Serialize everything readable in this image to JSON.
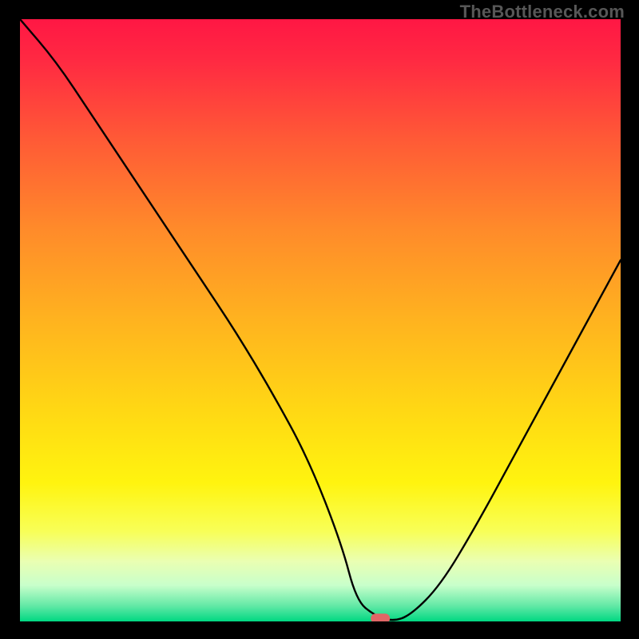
{
  "watermark": "TheBottleneck.com",
  "chart_data": {
    "type": "line",
    "title": "",
    "xlabel": "",
    "ylabel": "",
    "xlim": [
      0,
      100
    ],
    "ylim": [
      0,
      100
    ],
    "grid": false,
    "series": [
      {
        "name": "bottleneck-curve",
        "x": [
          0,
          6,
          12,
          18,
          24,
          30,
          36,
          42,
          48,
          53.5,
          56,
          59,
          62,
          65,
          70,
          76,
          82,
          88,
          94,
          100
        ],
        "values": [
          100,
          93,
          84,
          75,
          66,
          57,
          48,
          38,
          27,
          13,
          3.5,
          1,
          0,
          1,
          6,
          16,
          27,
          38,
          49,
          60
        ]
      }
    ],
    "annotations": [
      {
        "name": "sweet-spot-marker",
        "x": 60,
        "y": 0.5
      }
    ],
    "gradient_stops": [
      {
        "offset": 0.0,
        "color": "#ff1744"
      },
      {
        "offset": 0.07,
        "color": "#ff2a42"
      },
      {
        "offset": 0.2,
        "color": "#ff5a36"
      },
      {
        "offset": 0.35,
        "color": "#ff8b2a"
      },
      {
        "offset": 0.5,
        "color": "#ffb31f"
      },
      {
        "offset": 0.65,
        "color": "#ffd814"
      },
      {
        "offset": 0.77,
        "color": "#fff40f"
      },
      {
        "offset": 0.85,
        "color": "#f8ff57"
      },
      {
        "offset": 0.9,
        "color": "#eaffb2"
      },
      {
        "offset": 0.94,
        "color": "#c8ffcb"
      },
      {
        "offset": 0.975,
        "color": "#5fe8a5"
      },
      {
        "offset": 1.0,
        "color": "#00d882"
      }
    ],
    "marker_color": "#e06666"
  }
}
